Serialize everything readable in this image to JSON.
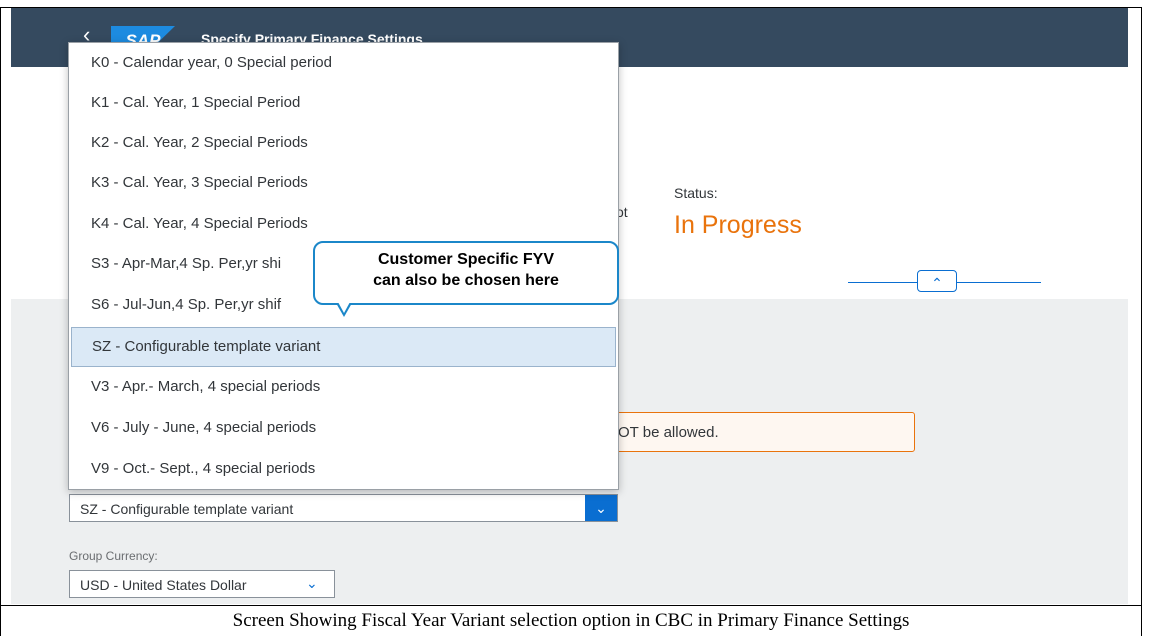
{
  "shell": {
    "back_icon": "back-arrow-icon",
    "logo": "SAP",
    "title": "Specify Primary Finance Settings"
  },
  "header": {
    "truncated_text": "ot",
    "status_label": "Status:",
    "status_value": "In Progress",
    "status_color": "#e9730c",
    "collapse_icon": "chevron-up-icon"
  },
  "warning": {
    "text": "OT be allowed."
  },
  "fiscal_year_variant": {
    "selected_value": "SZ - Configurable template variant",
    "dropdown_icon": "chevron-down-icon",
    "options": [
      "K0 - Calendar year, 0 Special period",
      "K1 - Cal. Year, 1 Special Period",
      "K2 - Cal. Year, 2 Special Periods",
      "K3 - Cal. Year, 3 Special Periods",
      "K4 - Cal. Year, 4 Special Periods",
      "S3 - Apr-Mar,4 Sp. Per,yr shi",
      "S6 - Jul-Jun,4 Sp. Per,yr shif",
      "SZ - Configurable template variant",
      "V3 - Apr.- March, 4 special periods",
      "V6 - July - June, 4 special periods",
      "V9 - Oct.- Sept., 4 special periods"
    ]
  },
  "group_currency": {
    "label": "Group Currency:",
    "value": "USD - United States Dollar",
    "dropdown_icon": "chevron-down-icon"
  },
  "callout": {
    "line1": "Customer Specific FYV",
    "line2": "can also be chosen here",
    "border_color": "#1b87c9"
  },
  "caption": "Screen Showing Fiscal Year Variant selection option in CBC in Primary Finance Settings",
  "colors": {
    "shellbar": "#354a5f",
    "accent": "#0a6ed1",
    "selected_row": "#dbe9f6"
  }
}
